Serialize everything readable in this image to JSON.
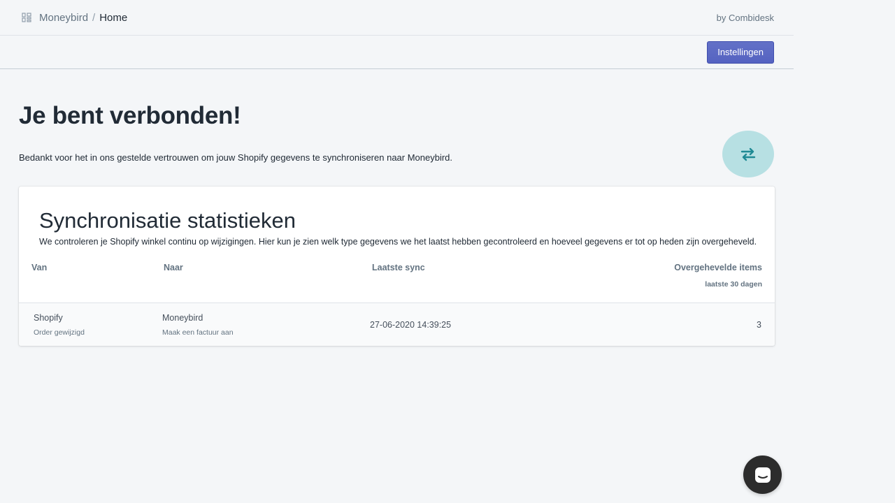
{
  "header": {
    "app_link": "Moneybird",
    "separator": "/",
    "current": "Home",
    "byline": "by Combidesk"
  },
  "actions": {
    "settings_label": "Instellingen"
  },
  "main": {
    "title": "Je bent verbonden!",
    "intro": "Bedankt voor het in ons gestelde vertrouwen om jouw Shopify gegevens te synchroniseren naar Moneybird."
  },
  "stats": {
    "title": "Synchronisatie statistieken",
    "description": "We controleren je Shopify winkel continu op wijzigingen. Hier kun je zien welk type gegevens we het laatst hebben gecontroleerd en hoeveel gegevens er tot op heden zijn overgeheveld.",
    "columns": {
      "from": "Van",
      "to": "Naar",
      "last_sync": "Laatste sync",
      "items": "Overgehevelde items",
      "items_sub": "laatste 30 dagen"
    },
    "rows": [
      {
        "from": "Shopify",
        "from_sub": "Order gewijzigd",
        "to": "Moneybird",
        "to_sub": "Maak een factuur aan",
        "last_sync": "27-06-2020 14:39:25",
        "items": "3"
      }
    ]
  },
  "icons": {
    "apps": "apps-grid-icon",
    "sync": "sync-arrows-icon",
    "chat": "chat-icon"
  },
  "colors": {
    "primary": "#5c6ac4",
    "sync_bubble": "#b7e0e3",
    "sync_icon": "#1f8a94",
    "background": "#f4f6f8"
  }
}
